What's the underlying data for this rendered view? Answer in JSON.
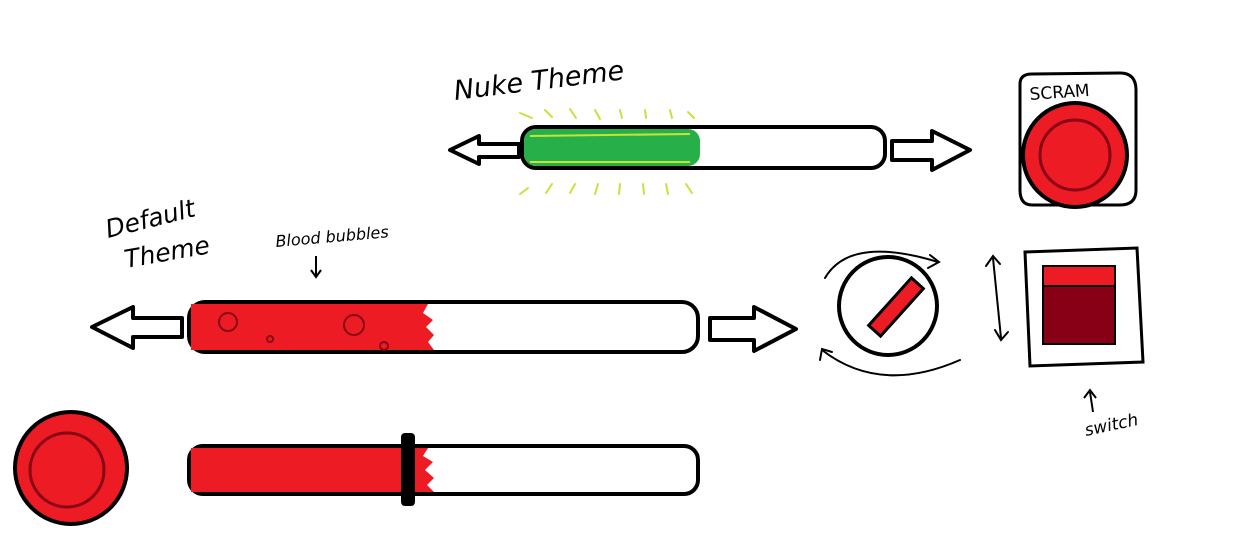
{
  "labels": {
    "nuke_theme": "Nuke Theme",
    "default_theme_line1": "Default",
    "default_theme_line2": "Theme",
    "blood_bubbles": "Blood bubbles",
    "scram": "SCRAM",
    "switch": "switch"
  },
  "sliders": {
    "nuke": {
      "fill": 0.49
    },
    "default": {
      "fill": 0.48
    },
    "handle": {
      "fill": 0.43
    }
  },
  "colors": {
    "nuke_fill": "#27b04a",
    "nuke_glow": "#c6e33a",
    "red": "#ed1c24",
    "dark_red": "#880015",
    "outline": "#000000"
  },
  "icons": {
    "left_arrow": "left-arrow-icon",
    "right_arrow": "right-arrow-icon",
    "rotate": "rotate-arrows-icon",
    "vertical_arrow": "vertical-double-arrow-icon",
    "down_arrow": "down-arrow-icon",
    "up_arrow": "up-arrow-icon"
  }
}
